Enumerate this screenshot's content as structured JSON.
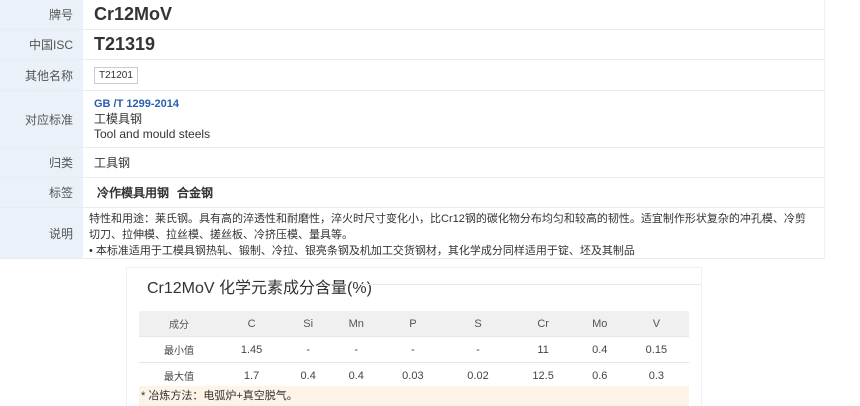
{
  "info": {
    "grade": {
      "label": "牌号",
      "value": "Cr12MoV"
    },
    "isc": {
      "label": "中国ISC",
      "value": "T21319"
    },
    "other": {
      "label": "其他名称",
      "value": "T21201"
    },
    "standard": {
      "label": "对应标准",
      "code": "GB /T 1299-2014",
      "name_cn": "工模具钢",
      "name_en": "Tool and mould steels"
    },
    "category": {
      "label": "归类",
      "value": "工具钢"
    },
    "tags": {
      "label": "标签",
      "items": [
        "冷作模具用钢",
        "合金钢"
      ]
    },
    "description": {
      "label": "说明",
      "line1": "特性和用途：莱氏钢。具有高的淬透性和耐磨性，淬火时尺寸变化小，比Cr12钢的碳化物分布均匀和较高的韧性。适宜制作形状复杂的冲孔模、冷剪切刀、拉伸模、拉丝模、搓丝板、冷挤压模、量具等。",
      "line2": "• 本标准适用于工模具钢热轧、锻制、冷拉、银亮条钢及机加工交货钢材，其化学成分同样适用于锭、坯及其制品"
    }
  },
  "composition": {
    "title": "Cr12MoV 化学元素成分含量(%)",
    "header": [
      "成分",
      "C",
      "Si",
      "Mn",
      "P",
      "S",
      "Cr",
      "Mo",
      "V"
    ],
    "min_row": [
      "最小值",
      "1.45",
      "-",
      "-",
      "-",
      "-",
      "11",
      "0.4",
      "0.15"
    ],
    "max_row": [
      "最大值",
      "1.7",
      "0.4",
      "0.4",
      "0.03",
      "0.02",
      "12.5",
      "0.6",
      "0.3"
    ],
    "note": "* 冶炼方法：电弧炉+真空脱气。"
  }
}
